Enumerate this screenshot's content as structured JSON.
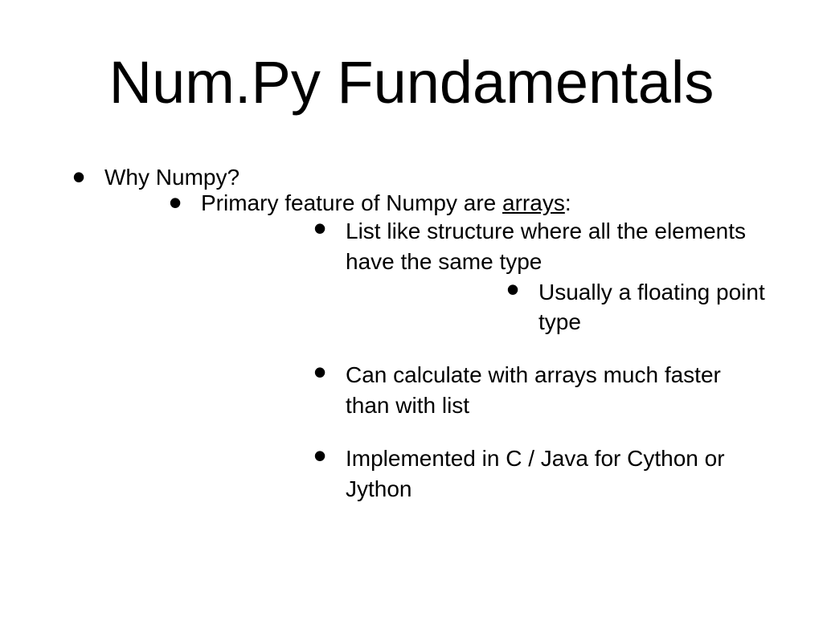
{
  "title": "Num.Py Fundamentals",
  "bullets": {
    "l1": "Why Numpy?",
    "l2": {
      "prefix": "Primary feature of Numpy are ",
      "underlined": "arrays",
      "suffix": ":"
    },
    "l3a": "List like structure where all the elements have the same type",
    "l4a": "Usually a floating point type",
    "l3b": "Can calculate with arrays much faster than with list",
    "l3c": "Implemented in C / Java for Cython or Jython"
  }
}
